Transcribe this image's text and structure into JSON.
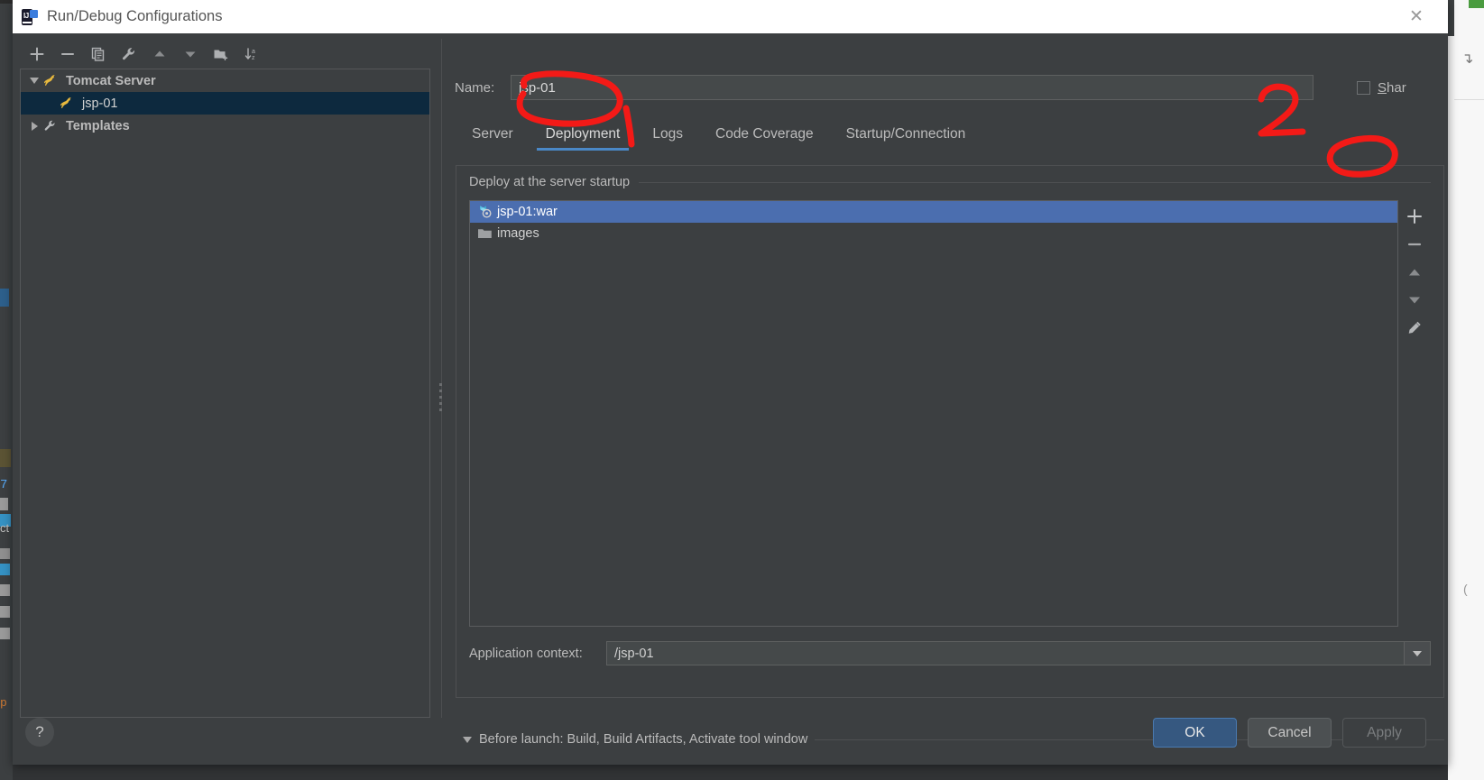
{
  "window": {
    "title": "Run/Debug Configurations",
    "icon": "intellij-idea-icon",
    "close_label": "✕"
  },
  "left_panel": {
    "toolbar": [
      {
        "name": "add-configuration-button",
        "icon": "plus-icon"
      },
      {
        "name": "remove-configuration-button",
        "icon": "minus-icon"
      },
      {
        "name": "copy-configuration-button",
        "icon": "copy-icon"
      },
      {
        "name": "edit-defaults-button",
        "icon": "wrench-icon"
      },
      {
        "name": "move-up-button",
        "icon": "arrow-up-icon"
      },
      {
        "name": "move-down-button",
        "icon": "arrow-down-icon"
      },
      {
        "name": "new-folder-button",
        "icon": "folder-add-icon"
      },
      {
        "name": "sort-configurations-button",
        "icon": "sort-alpha-icon"
      }
    ],
    "tree": [
      {
        "label": "Tomcat Server",
        "icon": "tomcat-icon",
        "twisty": "down",
        "level": 1,
        "selected": false
      },
      {
        "label": "jsp-01",
        "icon": "tomcat-icon",
        "twisty": "none",
        "level": 2,
        "selected": true
      },
      {
        "label": "Templates",
        "icon": "wrench-icon",
        "twisty": "right",
        "level": 1,
        "selected": false
      }
    ]
  },
  "right_panel": {
    "name_label": "Name:",
    "name_value": "jsp-01",
    "name_placeholder": "",
    "share_label_pre": "S",
    "share_label_post": "har",
    "share_checked": false,
    "tabs": [
      {
        "label": "Server",
        "active": false
      },
      {
        "label": "Deployment",
        "active": true
      },
      {
        "label": "Logs",
        "active": false
      },
      {
        "label": "Code Coverage",
        "active": false
      },
      {
        "label": "Startup/Connection",
        "active": false
      }
    ],
    "deploy_section_title": "Deploy at the server startup",
    "deploy_items": [
      {
        "label": "jsp-01:war",
        "icon": "artifact-icon",
        "selected": true
      },
      {
        "label": "images",
        "icon": "folder-icon",
        "selected": false
      }
    ],
    "list_toolbar": [
      {
        "name": "add-artifact-button",
        "icon": "plus-icon"
      },
      {
        "name": "remove-artifact-button",
        "icon": "minus-icon"
      },
      {
        "name": "move-artifact-up-button",
        "icon": "arrow-up-icon"
      },
      {
        "name": "move-artifact-down-button",
        "icon": "arrow-down-icon"
      },
      {
        "name": "edit-artifact-button",
        "icon": "pencil-icon"
      }
    ],
    "app_context_label": "Application context:",
    "app_context_value": "/jsp-01",
    "before_launch_text": "Before launch: Build, Build Artifacts, Activate tool window"
  },
  "footer": {
    "help_label": "?",
    "ok_label": "OK",
    "cancel_label": "Cancel",
    "apply_label": "Apply"
  },
  "annotations": {
    "color": "#f31a17",
    "number_label": "2",
    "marks": [
      {
        "name": "deployment-tab-circle",
        "shape": "ellipse-with-tail"
      },
      {
        "name": "add-button-circle",
        "shape": "ellipse"
      },
      {
        "name": "step-number-2",
        "shape": "text"
      }
    ]
  },
  "colors": {
    "dialog_bg": "#3c3f41",
    "titlebar_bg": "#ffffff",
    "tree_selected_bg": "#0d293e",
    "list_selected_bg": "#4b6eaf",
    "tab_underline": "#4a88c7",
    "ok_button_bg": "#365880",
    "annotation_red": "#f31a17"
  }
}
